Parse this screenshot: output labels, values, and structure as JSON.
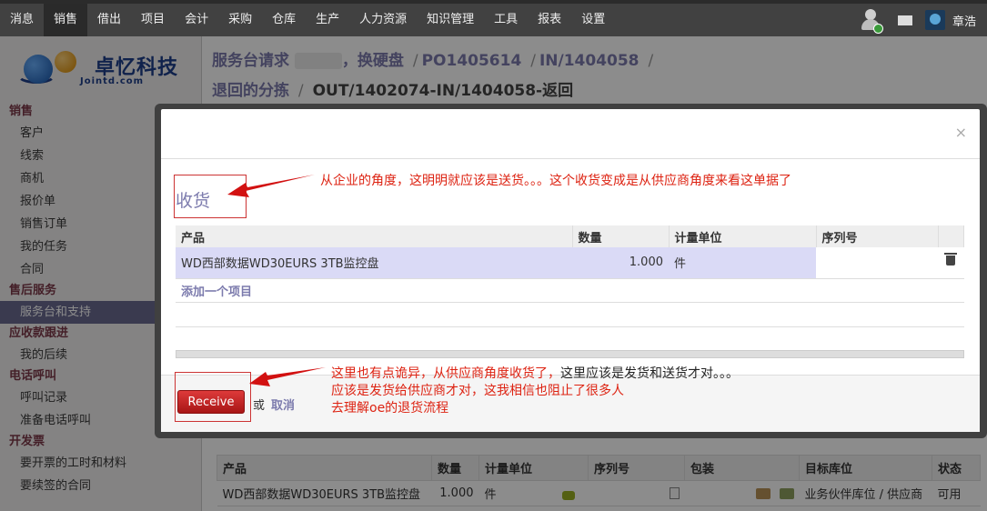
{
  "topmenu": [
    "消息",
    "销售",
    "借出",
    "项目",
    "会计",
    "采购",
    "仓库",
    "生产",
    "人力资源",
    "知识管理",
    "工具",
    "报表",
    "设置"
  ],
  "topmenu_active": 1,
  "user": {
    "name": "章浩"
  },
  "logo": {
    "name": "卓忆科技",
    "sub": "Jointd.com",
    "brand_color": "#1e3f8a"
  },
  "sidebar": {
    "groups": [
      {
        "title": "销售",
        "items": [
          "客户",
          "线索",
          "商机",
          "报价单",
          "销售订单",
          "我的任务",
          "合同"
        ]
      },
      {
        "title": "售后服务",
        "items": [
          "服务台和支持"
        ]
      },
      {
        "title": "应收款跟进",
        "items": [
          "我的后续"
        ]
      },
      {
        "title": "电话呼叫",
        "items": [
          "呼叫记录",
          "准备电话呼叫"
        ]
      },
      {
        "title": "开发票",
        "items": [
          "要开票的工时和材料",
          "要续签的合同"
        ]
      }
    ],
    "active_item": "服务台和支持"
  },
  "breadcrumb": {
    "line1": [
      "服务台请求",
      "，换硬盘",
      "PO1405614",
      "IN/1404058"
    ],
    "line2_link": "退回的分拣",
    "line2_current": "OUT/1402074-IN/1404058-返回"
  },
  "background_table": {
    "headers": [
      "产品",
      "数量",
      "计量单位",
      "序列号",
      "包装",
      "目标库位",
      "状态"
    ],
    "row": {
      "product": "WD西部数据WD30EURS 3TB监控盘",
      "qty": "1.000",
      "uom": "件",
      "location": "业务伙伴库位 / 供应商",
      "state": "可用"
    }
  },
  "modal": {
    "title": "收货",
    "close": "×",
    "headers": [
      "产品",
      "数量",
      "计量单位",
      "序列号"
    ],
    "row": {
      "product": "WD西部数据WD30EURS 3TB监控盘",
      "qty": "1.000",
      "uom": "件",
      "serial": ""
    },
    "add_item": "添加一个项目",
    "receive_button": "Receive",
    "or": "或",
    "cancel": "取消"
  },
  "annotations": {
    "note1": "从企业的角度，这明明就应该是送货。。。这个收货变成是从供应商角度来看这单据了",
    "note2_red": "这里也有点诡异，从供应商角度收货了，",
    "note2_black": "这里应该是发货和送货才对。。。",
    "note3": "应该是发货给供应商才对，这我相信也阻止了很多人",
    "note4": "去理解oe的退货流程",
    "color": "#d21111"
  }
}
